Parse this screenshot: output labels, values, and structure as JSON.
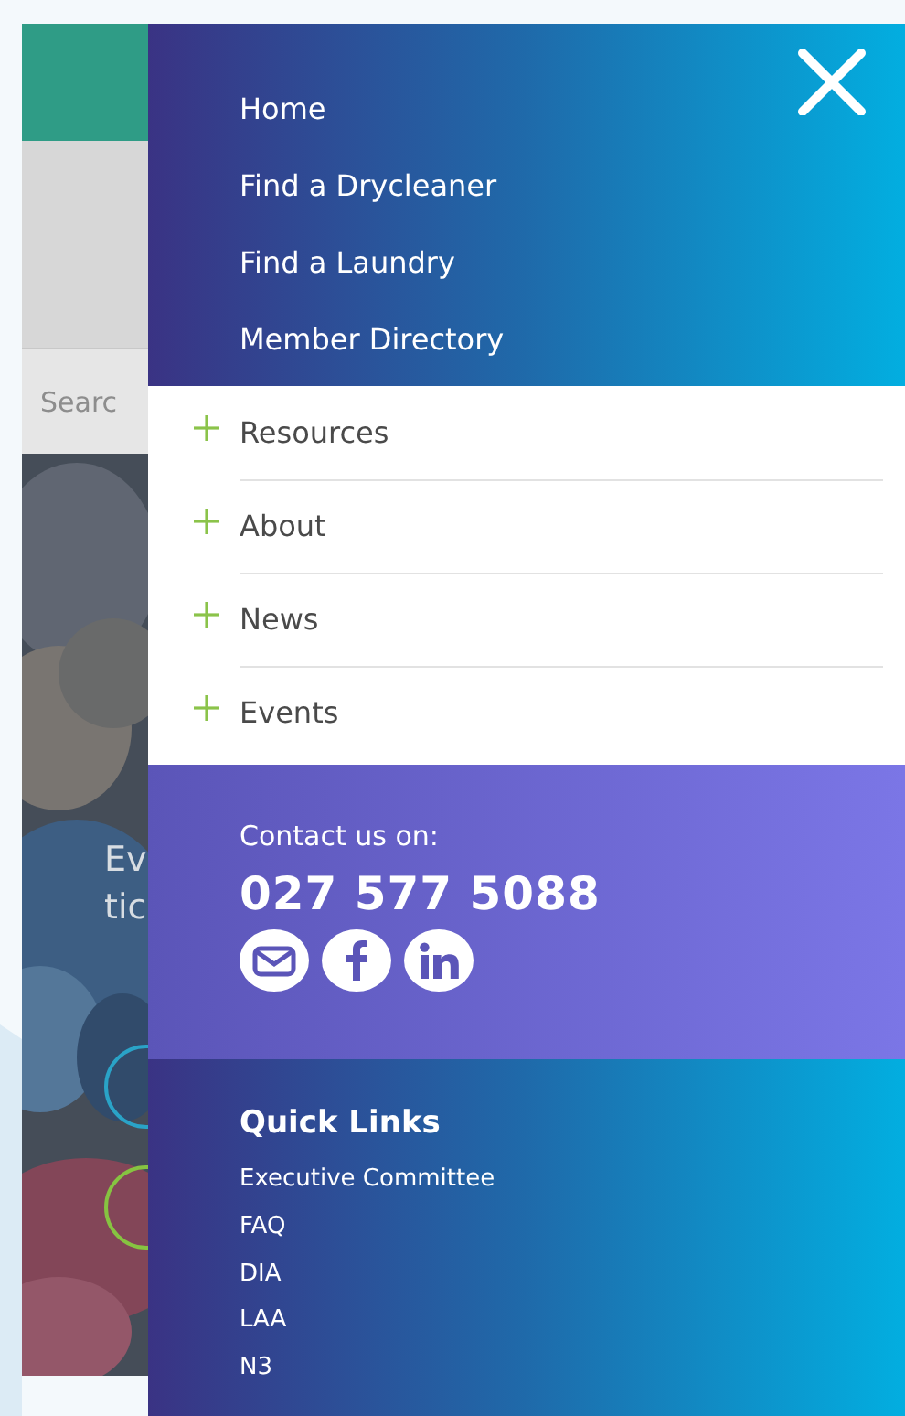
{
  "background_page": {
    "search": {
      "placeholder": "Searc"
    },
    "photo_text": [
      "Ev",
      "tic"
    ]
  },
  "menu": {
    "main_links": [
      "Home",
      "Find a Drycleaner",
      "Find a Laundry",
      "Member Directory"
    ],
    "sections": [
      {
        "label": "Resources",
        "expanded": false
      },
      {
        "label": "About",
        "expanded": false
      },
      {
        "label": "News",
        "expanded": false
      },
      {
        "label": "Events",
        "expanded": false
      }
    ],
    "contact": {
      "label": "Contact us on:",
      "phone": "027 577 5088",
      "social": [
        {
          "kind": "email"
        },
        {
          "kind": "facebook"
        },
        {
          "kind": "linkedin"
        }
      ]
    },
    "quick_links": {
      "title": "Quick Links",
      "items": [
        "Executive Committee",
        "FAQ",
        "DIA",
        "LAA",
        "N3"
      ]
    }
  }
}
